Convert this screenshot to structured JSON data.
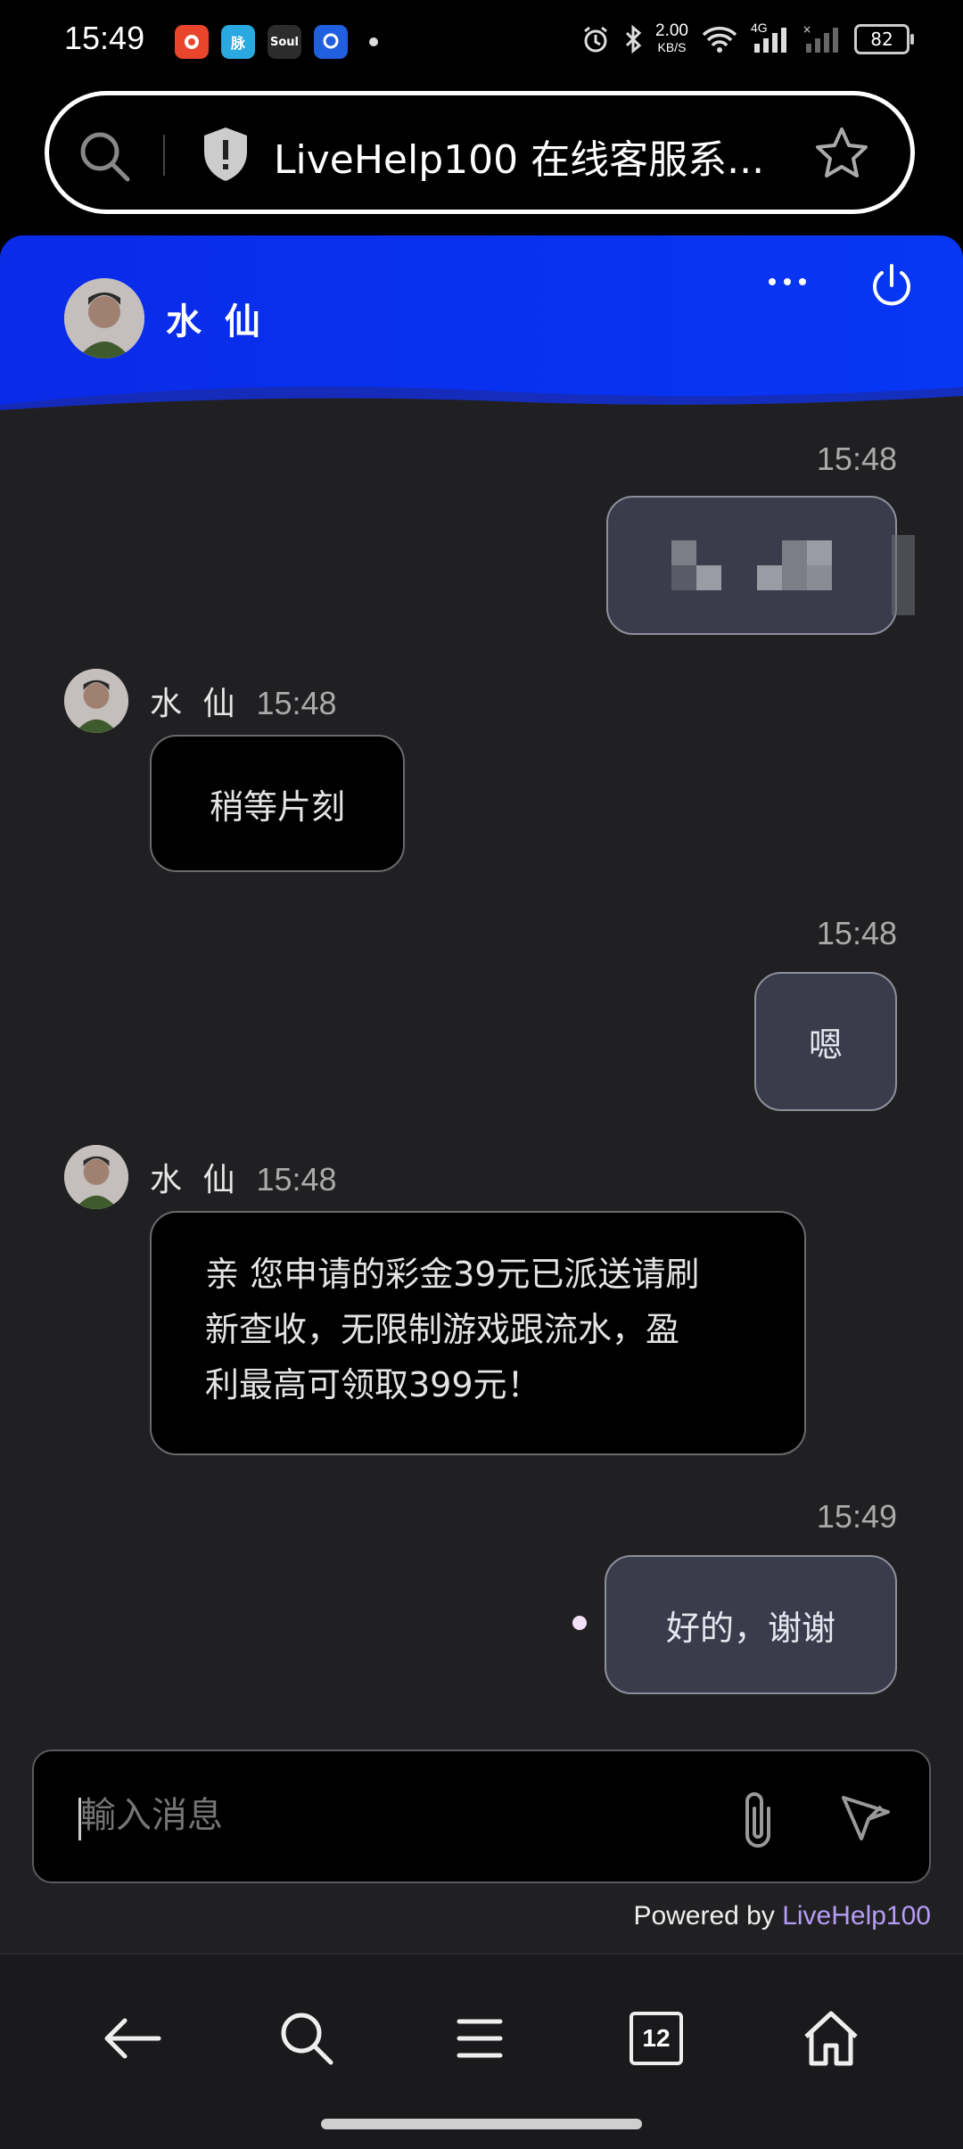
{
  "status_bar": {
    "time": "15:49",
    "speed_value": "2.00",
    "speed_unit": "KB/S",
    "network": "4G",
    "battery": "82",
    "apps": [
      {
        "name": "app-1",
        "color": "#e8452c",
        "label": ""
      },
      {
        "name": "app-2",
        "color": "#2aa8e0",
        "label": "脉"
      },
      {
        "name": "app-3",
        "color": "#2c2c2c",
        "label": "Soul"
      },
      {
        "name": "app-4",
        "color": "#1f5fe0",
        "label": ""
      }
    ]
  },
  "url_bar": {
    "title": "LiveHelp100 在线客服系..."
  },
  "chat": {
    "agent_name": "水 仙",
    "messages": [
      {
        "side": "out",
        "time": "15:48",
        "text": ""
      },
      {
        "side": "in",
        "name": "水 仙",
        "time": "15:48",
        "text": "稍等片刻"
      },
      {
        "side": "out",
        "time": "15:48",
        "text": "嗯"
      },
      {
        "side": "in",
        "name": "水 仙",
        "time": "15:48",
        "lines": [
          "亲 您申请的彩金39元已派送请刷",
          "新查收，无限制游戏跟流水，盈",
          "利最高可领取399元！"
        ]
      },
      {
        "side": "out",
        "time": "15:49",
        "text": "好的，谢谢"
      }
    ],
    "input_placeholder": "輸入消息",
    "powered_prefix": "Powered by ",
    "powered_link": "LiveHelp100"
  },
  "colors": {
    "header_blue": "#0a2be8",
    "panel_bg": "#202022",
    "link": "#b69cf6"
  },
  "bottom_nav": {
    "tab_count": "12"
  }
}
